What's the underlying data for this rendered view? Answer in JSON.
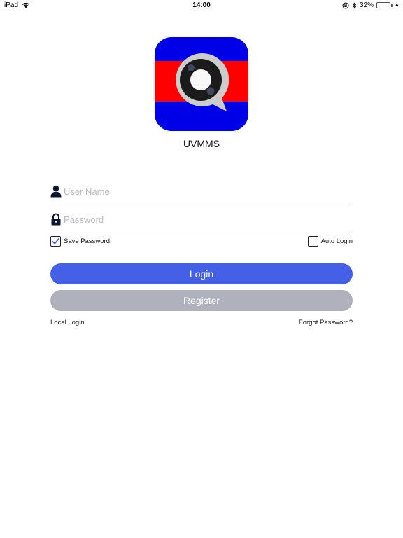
{
  "status_bar": {
    "device": "iPad",
    "time": "14:00",
    "battery_percent": "32%",
    "battery_level": 0.32,
    "battery_color": "#4cd964"
  },
  "app": {
    "name": "UVMMS",
    "logo_colors": {
      "blue": "#0000e6",
      "red": "#ff0000"
    }
  },
  "form": {
    "username": {
      "placeholder": "User Name",
      "value": "",
      "icon": "person-icon"
    },
    "password": {
      "placeholder": "Password",
      "value": "",
      "icon": "lock-icon"
    },
    "save_password": {
      "label": "Save Password",
      "checked": true
    },
    "auto_login": {
      "label": "Auto Login",
      "checked": false
    }
  },
  "buttons": {
    "login": "Login",
    "register": "Register",
    "login_color": "#4460e6",
    "register_color": "#afb2bd"
  },
  "links": {
    "local_login": "Local Login",
    "forgot_password": "Forgot Password?"
  }
}
